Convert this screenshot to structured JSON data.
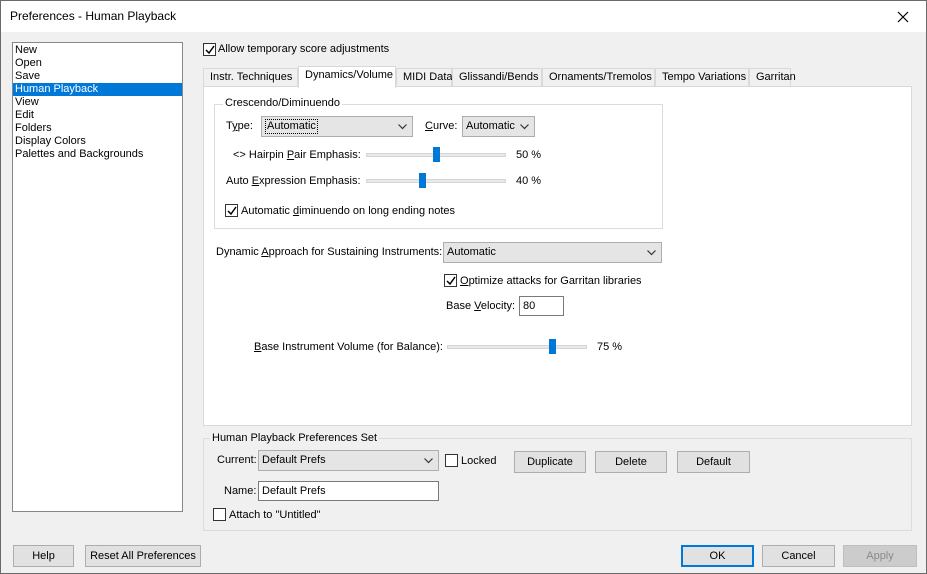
{
  "window": {
    "title": "Preferences - Human Playback"
  },
  "categories": [
    {
      "label": "New",
      "selected": false
    },
    {
      "label": "Open",
      "selected": false
    },
    {
      "label": "Save",
      "selected": false
    },
    {
      "label": "Human Playback",
      "selected": true
    },
    {
      "label": "View",
      "selected": false
    },
    {
      "label": "Edit",
      "selected": false
    },
    {
      "label": "Folders",
      "selected": false
    },
    {
      "label": "Display Colors",
      "selected": false
    },
    {
      "label": "Palettes and Backgrounds",
      "selected": false
    }
  ],
  "allow_temp": {
    "label": "Allow temporary score adjustments",
    "checked": true
  },
  "tabs": [
    {
      "label": "Instr. Techniques",
      "active": false
    },
    {
      "label": "Dynamics/Volume",
      "active": true
    },
    {
      "label": "MIDI Data",
      "active": false
    },
    {
      "label": "Glissandi/Bends",
      "active": false
    },
    {
      "label": "Ornaments/Tremolos",
      "active": false
    },
    {
      "label": "Tempo Variations",
      "active": false
    },
    {
      "label": "Garritan",
      "active": false
    }
  ],
  "crescendo": {
    "group_label": "Crescendo/Diminuendo",
    "type_label_pre": "T",
    "type_label_u": "y",
    "type_label_post": "pe:",
    "type_value": "Automatic",
    "curve_label_pre": "",
    "curve_label_u": "C",
    "curve_label_post": "urve:",
    "curve_value": "Automatic",
    "hairpin_label_pre": "<> Hairpin ",
    "hairpin_label_u": "P",
    "hairpin_label_post": "air Emphasis:",
    "hairpin_value": "50 %",
    "hairpin_percent": 50,
    "autoexp_label_pre": "Auto ",
    "autoexp_label_u": "E",
    "autoexp_label_post": "xpression Emphasis:",
    "autoexp_value": "40 %",
    "autoexp_percent": 40,
    "dim_label_pre": "Automatic ",
    "dim_label_u": "d",
    "dim_label_post": "iminuendo on long ending notes",
    "dim_checked": true
  },
  "dynamic_approach": {
    "label_pre": "Dynamic ",
    "label_u": "A",
    "label_post": "pproach for Sustaining Instruments:",
    "value": "Automatic"
  },
  "optimize": {
    "label_pre": "",
    "label_u": "O",
    "label_post": "ptimize attacks for Garritan libraries",
    "checked": true
  },
  "base_velocity": {
    "label_pre": "Base ",
    "label_u": "V",
    "label_post": "elocity:",
    "value": "80"
  },
  "base_volume": {
    "label_pre": "",
    "label_u": "B",
    "label_post": "ase Instrument Volume (for Balance):",
    "value": "75 %",
    "percent": 75
  },
  "prefs_set": {
    "group_label": "Human Playback Preferences Set",
    "current_label": "Current:",
    "current_value": "Default Prefs",
    "locked_label": "Locked",
    "locked_checked": false,
    "duplicate_label": "Duplicate",
    "delete_label": "Delete",
    "default_label": "Default",
    "name_label": "Name:",
    "name_value": "Default Prefs",
    "attach_label": "Attach to \"Untitled\"",
    "attach_checked": false
  },
  "footer": {
    "help_label": "Help",
    "reset_label": "Reset All Preferences",
    "ok_label": "OK",
    "cancel_label": "Cancel",
    "apply_label": "Apply"
  },
  "icons": {
    "close": "close-icon",
    "check": "checkmark-icon",
    "dropdown": "chevron-down-icon"
  }
}
